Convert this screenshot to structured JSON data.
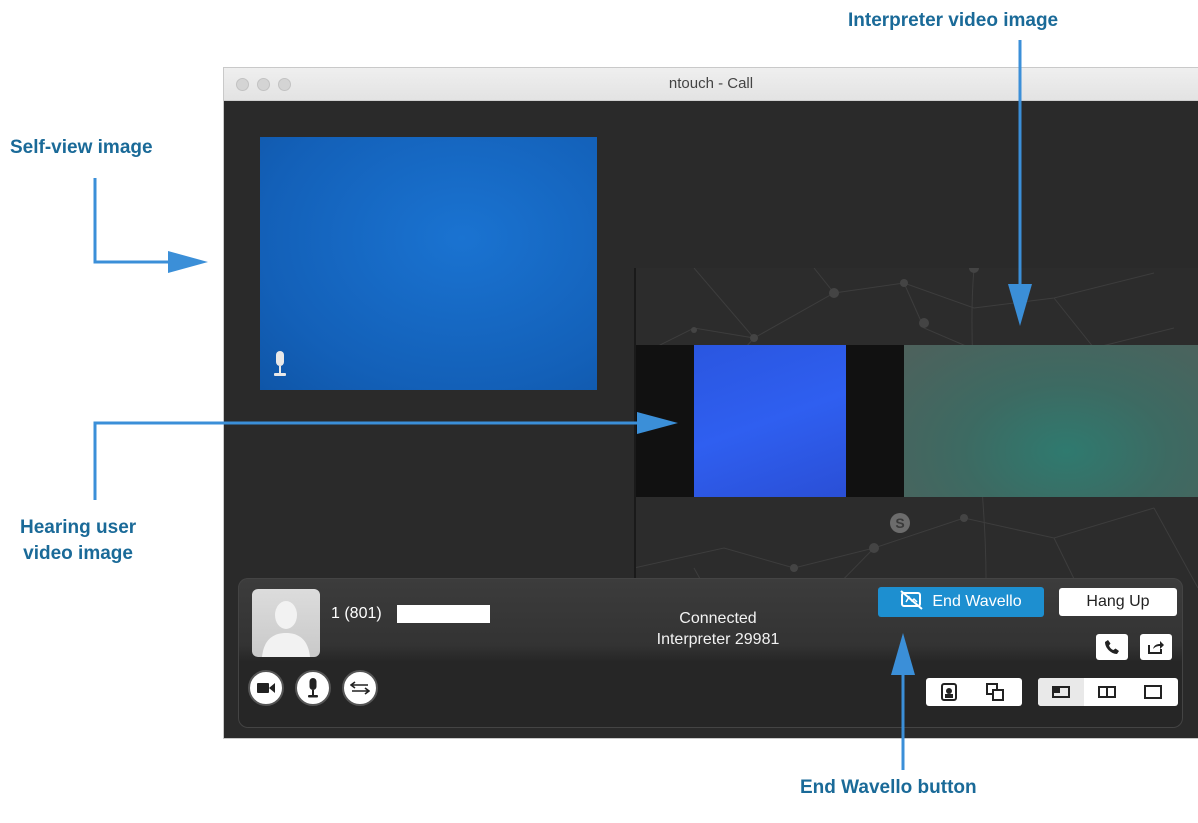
{
  "annotations": {
    "self_view": "Self-view image",
    "interpreter_video": "Interpreter video image",
    "hearing_user_line1": "Hearing user",
    "hearing_user_line2": "video image",
    "end_wavello": "End Wavello button"
  },
  "window": {
    "title": "ntouch - Call"
  },
  "call": {
    "number": "1 (801)",
    "status_line1": "Connected",
    "status_line2": "Interpreter 29981",
    "end_wavello_label": "End Wavello",
    "hang_up_label": "Hang Up"
  },
  "colors": {
    "accent": "#1d8fd0",
    "annotation": "#1a6a98",
    "arrow": "#3b8fd8",
    "window_bg": "#2a2a2a",
    "self_view": "#1565c0"
  },
  "icons": {
    "self_mic": "microphone-icon",
    "end_wavello": "wavello-off-icon",
    "phone": "phone-icon",
    "share": "share-icon",
    "camera": "camera-icon",
    "mic": "microphone-icon",
    "swap": "swap-arrows-icon",
    "layout_a": "self-view-toggle-icon",
    "layout_b": "picture-in-picture-icon",
    "layout_c": "layout-small-icon",
    "layout_d": "layout-split-icon",
    "layout_e": "layout-full-icon"
  }
}
